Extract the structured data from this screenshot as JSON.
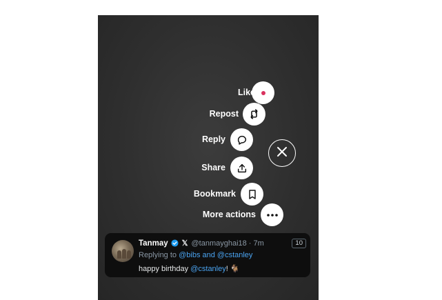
{
  "actions": [
    {
      "label": "Like",
      "icon": "heart-icon"
    },
    {
      "label": "Repost",
      "icon": "repost-icon"
    },
    {
      "label": "Reply",
      "icon": "reply-bubble-icon"
    },
    {
      "label": "Share",
      "icon": "share-upload-icon"
    },
    {
      "label": "Bookmark",
      "icon": "bookmark-icon"
    },
    {
      "label": "More actions",
      "icon": "more-dots-icon"
    }
  ],
  "close": {
    "icon": "close-icon"
  },
  "tweet": {
    "author_name": "Tanmay",
    "x_logo": "𝕏",
    "handle_time": "@tanmayghai18 · 7m",
    "count_badge": "10",
    "replying_prefix": "Replying to ",
    "replying_to": "@bibs and @cstanley",
    "body_prefix": "happy birthday ",
    "body_mention": "@cstanley",
    "body_suffix": "! 🐐"
  },
  "colors": {
    "accent_blue": "#4aa3f0",
    "like_dot": "#d9325e",
    "verified": "#1d9bf0"
  }
}
